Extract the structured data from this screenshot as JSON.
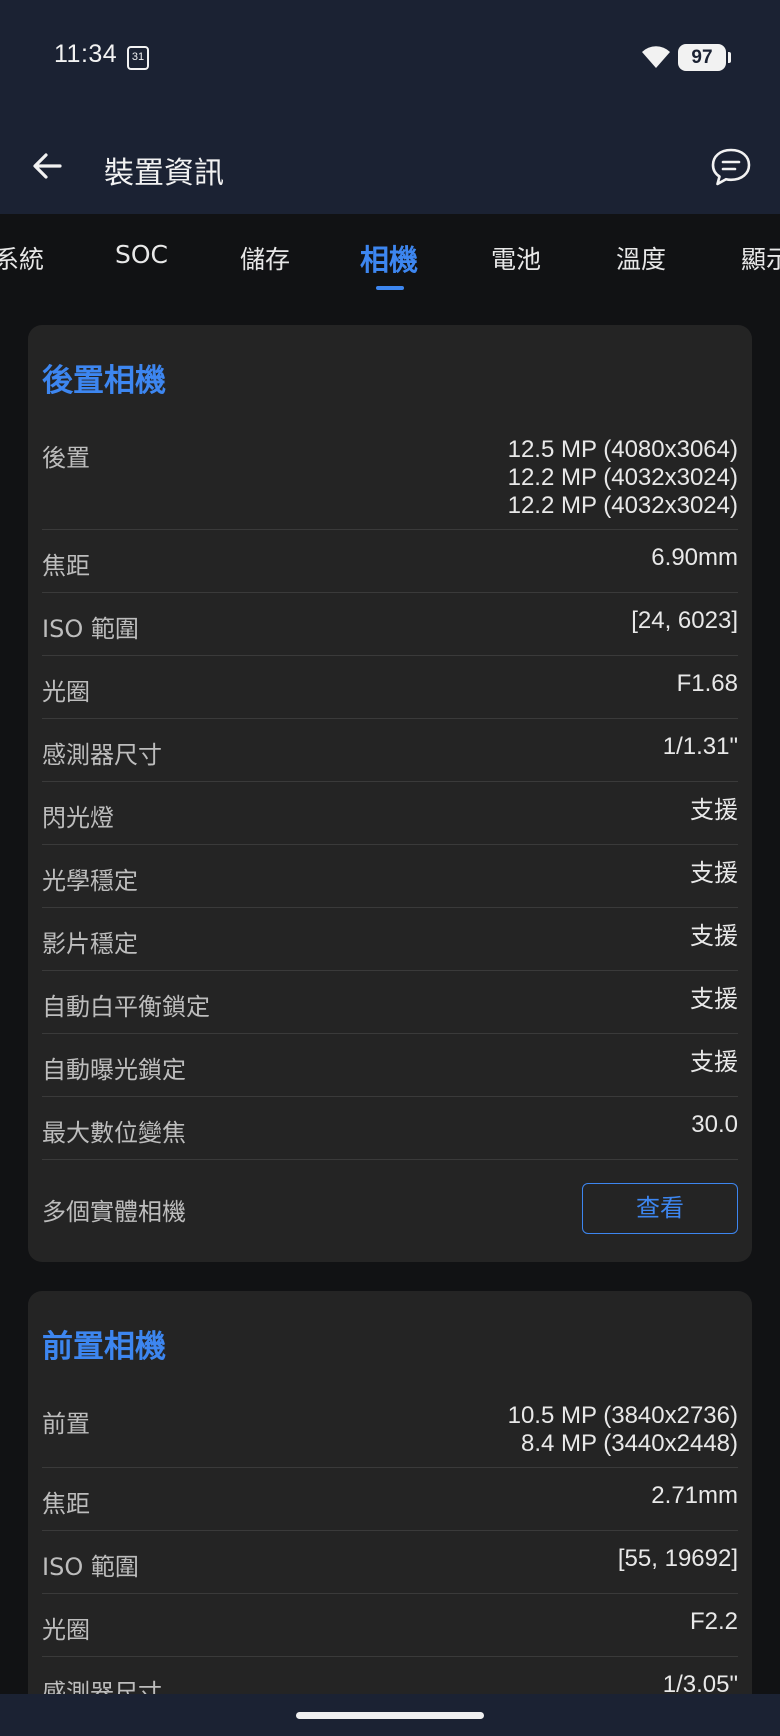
{
  "status": {
    "time": "11:34",
    "calendar_day": "31",
    "battery": "97"
  },
  "app_bar": {
    "title": "裝置資訊"
  },
  "tabs": [
    {
      "label": "系統"
    },
    {
      "label": "SOC"
    },
    {
      "label": "儲存"
    },
    {
      "label": "相機",
      "active": true
    },
    {
      "label": "電池"
    },
    {
      "label": "溫度"
    },
    {
      "label": "顯示"
    }
  ],
  "rear_camera": {
    "title": "後置相機",
    "resolution_label": "後置",
    "resolutions": [
      "12.5 MP (4080x3064)",
      "12.2 MP (4032x3024)",
      "12.2 MP (4032x3024)"
    ],
    "rows": [
      {
        "label": "焦距",
        "value": "6.90mm"
      },
      {
        "label": "ISO 範圍",
        "value": "[24, 6023]"
      },
      {
        "label": "光圈",
        "value": "F1.68"
      },
      {
        "label": "感測器尺寸",
        "value": "1/1.31\""
      },
      {
        "label": "閃光燈",
        "value": "支援"
      },
      {
        "label": "光學穩定",
        "value": "支援"
      },
      {
        "label": "影片穩定",
        "value": "支援"
      },
      {
        "label": "自動白平衡鎖定",
        "value": "支援"
      },
      {
        "label": "自動曝光鎖定",
        "value": "支援"
      },
      {
        "label": "最大數位變焦",
        "value": "30.0"
      }
    ],
    "multi_camera_label": "多個實體相機",
    "view_button_label": "查看"
  },
  "front_camera": {
    "title": "前置相機",
    "resolution_label": "前置",
    "resolutions": [
      "10.5 MP (3840x2736)",
      "8.4 MP (3440x2448)"
    ],
    "rows": [
      {
        "label": "焦距",
        "value": "2.71mm"
      },
      {
        "label": "ISO 範圍",
        "value": "[55, 19692]"
      },
      {
        "label": "光圈",
        "value": "F2.2"
      },
      {
        "label": "感測器尺寸",
        "value": "1/3.05\""
      }
    ]
  },
  "colors": {
    "accent": "#3d86f0",
    "header_bg": "#1b2233",
    "card_bg": "#242424",
    "page_bg": "#111214"
  }
}
